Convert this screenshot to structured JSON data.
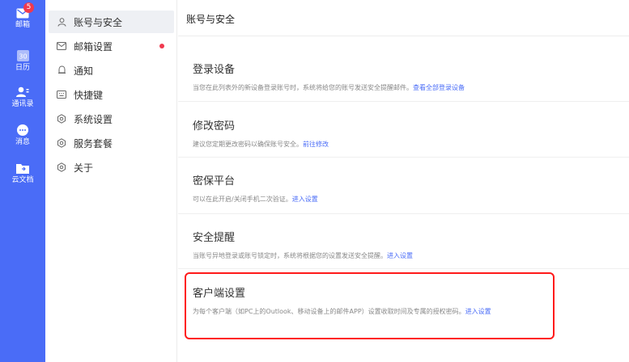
{
  "rail": {
    "items": [
      {
        "label": "邮箱",
        "icon": "mail-icon",
        "badge": "5"
      },
      {
        "label": "日历",
        "icon": "calendar-icon",
        "icon_text": "30"
      },
      {
        "label": "通讯录",
        "icon": "contacts-icon"
      },
      {
        "label": "消息",
        "icon": "chat-icon"
      },
      {
        "label": "云文档",
        "icon": "cloud-doc-icon"
      }
    ],
    "color": "#4a6cf7"
  },
  "sidebar": {
    "items": [
      {
        "label": "账号与安全",
        "icon": "user-icon",
        "active": true
      },
      {
        "label": "邮箱设置",
        "icon": "envelope-icon",
        "dot": true
      },
      {
        "label": "通知",
        "icon": "bell-icon"
      },
      {
        "label": "快捷键",
        "icon": "keyboard-icon"
      },
      {
        "label": "系统设置",
        "icon": "gear-icon"
      },
      {
        "label": "服务套餐",
        "icon": "gear-icon"
      },
      {
        "label": "关于",
        "icon": "gear-icon"
      }
    ]
  },
  "main": {
    "title": "账号与安全",
    "sections": [
      {
        "title": "登录设备",
        "desc": "当您在此列表外的新设备登录账号时，系统将给您的账号发送安全提醒邮件。",
        "link": "查看全部登录设备"
      },
      {
        "title": "修改密码",
        "desc": "建议您定期更改密码以确保账号安全。",
        "link": "前往修改"
      },
      {
        "title": "密保平台",
        "desc": "可以在此开启/关闭手机二次验证。",
        "link": "进入设置"
      },
      {
        "title": "安全提醒",
        "desc": "当账号异地登录或账号锁定时，系统将根据您的设置发送安全提醒。",
        "link": "进入设置"
      },
      {
        "title": "客户端设置",
        "desc": "为每个客户端（如PC上的Outlook、移动设备上的邮件APP）设置收取时间及专属的授权密码。",
        "link": "进入设置"
      }
    ]
  },
  "colors": {
    "accent": "#4a6cf7",
    "highlight": "#ff1a1a",
    "badge": "#f0394e"
  }
}
